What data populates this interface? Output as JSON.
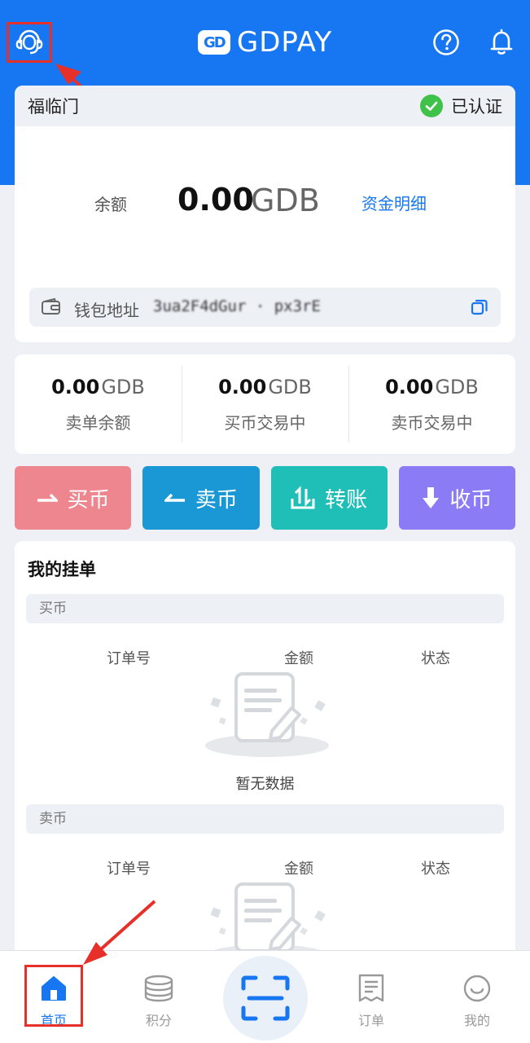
{
  "header": {
    "app_name": "GDPAY",
    "logo_mark": "GD",
    "icons": [
      "customer-service-icon",
      "help-icon",
      "bell-icon"
    ]
  },
  "account": {
    "merchant_name": "福临门",
    "verified_label": "已认证"
  },
  "balance": {
    "label": "余额",
    "amount": "0.00",
    "unit": "GDB",
    "detail_link": "资金明细"
  },
  "wallet": {
    "label": "钱包地址",
    "address_masked": "3ua2F4dGur · px3rE"
  },
  "stats": [
    {
      "value": "0.00",
      "unit": "GDB",
      "label": "卖单余额"
    },
    {
      "value": "0.00",
      "unit": "GDB",
      "label": "买币交易中"
    },
    {
      "value": "0.00",
      "unit": "GDB",
      "label": "卖币交易中"
    }
  ],
  "actions": [
    {
      "label": "买币",
      "color": "#ee8690",
      "icon": "arrow-right-icon"
    },
    {
      "label": "卖币",
      "color": "#1a98d5",
      "icon": "arrow-left-icon"
    },
    {
      "label": "转账",
      "color": "#1fbfb8",
      "icon": "transfer-icon"
    },
    {
      "label": "收币",
      "color": "#8b7cf6",
      "icon": "download-icon"
    }
  ],
  "orders": {
    "title": "我的挂单",
    "sections": [
      {
        "name": "买币",
        "columns": [
          "订单号",
          "金额",
          "状态"
        ],
        "empty_text": "暂无数据"
      },
      {
        "name": "卖币",
        "columns": [
          "订单号",
          "金额",
          "状态"
        ],
        "empty_text": ""
      }
    ]
  },
  "tabbar": {
    "items": [
      {
        "label": "首页",
        "icon": "home-icon",
        "active": true
      },
      {
        "label": "积分",
        "icon": "coins-icon",
        "active": false
      },
      {
        "label": "",
        "icon": "scan-icon",
        "active": false
      },
      {
        "label": "订单",
        "icon": "order-icon",
        "active": false
      },
      {
        "label": "我的",
        "icon": "profile-icon",
        "active": false
      }
    ]
  },
  "colors": {
    "brand_blue": "#1776f2",
    "annotation_red": "#e8302a",
    "verified_green": "#3fc14a"
  }
}
